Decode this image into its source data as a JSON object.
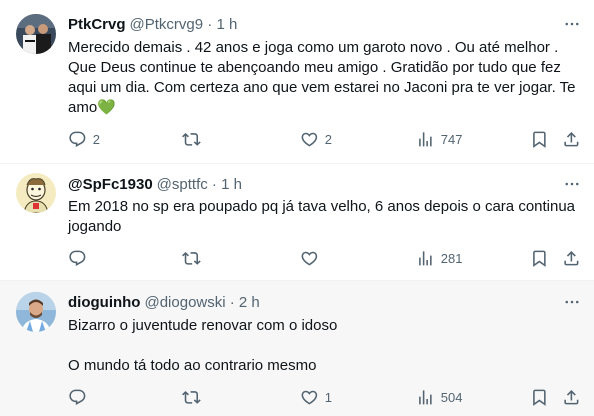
{
  "tweets": [
    {
      "display_name": "PtkCrvg",
      "handle": "@Ptkcrvg9 · 1 h",
      "text": "Merecido demais . 42 anos e joga como um garoto novo . Ou até melhor . Que Deus continue te abençoando meu amigo . Gratidão por tudo que fez aqui um dia. Com certeza ano que vem estarei no Jaconi pra te ver jogar. Te amo💚",
      "replies": "2",
      "reposts": "",
      "likes": "2",
      "views": "747"
    },
    {
      "display_name": "@SpFc1930",
      "handle": "@spttfc · 1 h",
      "text": "Em 2018 no sp era poupado pq já tava velho, 6 anos depois o cara continua jogando",
      "replies": "",
      "reposts": "",
      "likes": "",
      "views": "281"
    },
    {
      "display_name": "dioguinho",
      "handle": "@diogowski · 2 h",
      "text": "Bizarro o juventude renovar com o idoso\n\nO mundo tá todo ao contrario mesmo",
      "replies": "",
      "reposts": "",
      "likes": "1",
      "views": "504"
    }
  ],
  "icons": {
    "more": "more-dots-icon",
    "reply": "reply-icon",
    "repost": "repost-icon",
    "like": "heart-icon",
    "views": "views-chart-icon",
    "bookmark": "bookmark-icon",
    "share": "share-icon"
  },
  "colors": {
    "text": "#0f1419",
    "secondary": "#536471",
    "divider": "#eff3f4",
    "hover_bg": "#f7f7f7",
    "heart_emoji": "#5fc85a"
  }
}
